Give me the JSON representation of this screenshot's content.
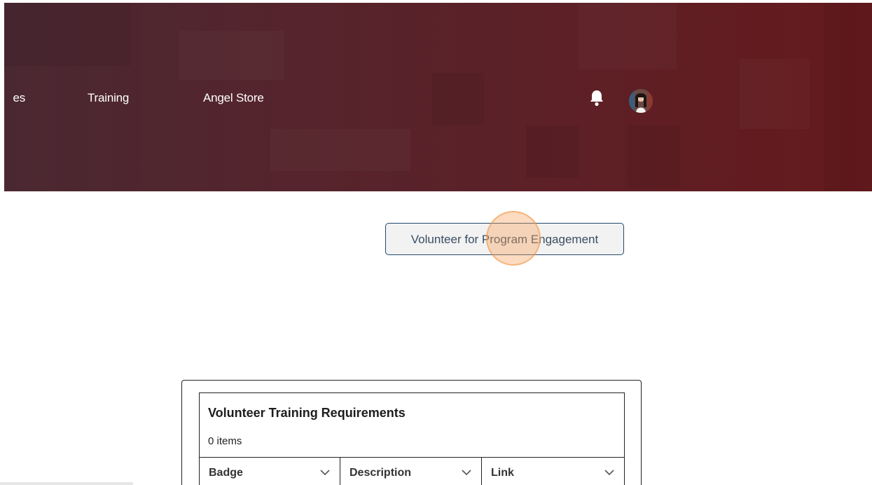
{
  "header": {
    "nav_items": [
      "es",
      "Training",
      "Angel Store"
    ]
  },
  "notifications": {
    "icon": "bell-icon"
  },
  "user": {
    "avatar_icon": "user-avatar"
  },
  "action": {
    "volunteer_button_label": "Volunteer for Program Engagement"
  },
  "training_table": {
    "title": "Volunteer Training Requirements",
    "count": "0 items",
    "columns": [
      "Badge",
      "Description",
      "Link"
    ]
  },
  "colors": {
    "header_gradient_start": "#4a2832",
    "header_gradient_end": "#651a1d",
    "button_border": "#23496b",
    "click_indicator": "#f6a05a"
  }
}
